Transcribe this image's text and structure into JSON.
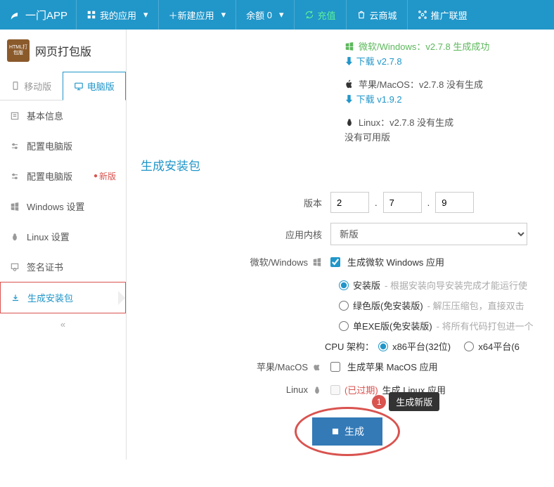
{
  "brand": "一门APP",
  "nav": {
    "myapps": "我的应用",
    "newapp": "新建应用",
    "balance_label": "余额",
    "balance_value": "0",
    "recharge": "充值",
    "mall": "云商城",
    "promote": "推广联盟"
  },
  "app": {
    "icon_text": "HTML打包版",
    "name": "网页打包版"
  },
  "tabs": {
    "mobile": "移动版",
    "desktop": "电脑版"
  },
  "menu": {
    "basic": "基本信息",
    "config1": "配置电脑版",
    "config2": "配置电脑版",
    "new_badge": "新版",
    "windows": "Windows 设置",
    "linux": "Linux 设置",
    "cert": "签名证书",
    "build": "生成安装包"
  },
  "status": {
    "win_label": "微软/Windows：v2.7.8 生成成功",
    "win_dl": "下载 v2.7.8",
    "mac_label": "苹果/MacOS：v2.7.8 没有生成",
    "mac_dl": "下载 v1.9.2",
    "linux_label": "Linux：v2.7.8 没有生成",
    "linux_none": "没有可用版"
  },
  "section_title": "生成安装包",
  "form": {
    "version_label": "版本",
    "v1": "2",
    "v2": "7",
    "v3": "9",
    "kernel_label": "应用内核",
    "kernel_value": "新版",
    "win_label": "微软/Windows",
    "win_check": "生成微软 Windows 应用",
    "opt_install": "安装版",
    "opt_install_hint": "- 根据安装向导安装完成才能运行使",
    "opt_green": "绿色版(免安装版)",
    "opt_green_hint": "- 解压压缩包，直接双击",
    "opt_exe": "单EXE版(免安装版)",
    "opt_exe_hint": "- 将所有代码打包进一个",
    "cpu_label": "CPU 架构：",
    "cpu_x86": "x86平台(32位)",
    "cpu_x64": "x64平台(6",
    "mac_label": "苹果/MacOS",
    "mac_check": "生成苹果 MacOS 应用",
    "linux_label": "Linux",
    "linux_expired": "(已过期)",
    "linux_check": "生成 Linux 应用"
  },
  "gen": {
    "button": "生成",
    "callout_num": "1",
    "callout_text": "生成新版"
  }
}
